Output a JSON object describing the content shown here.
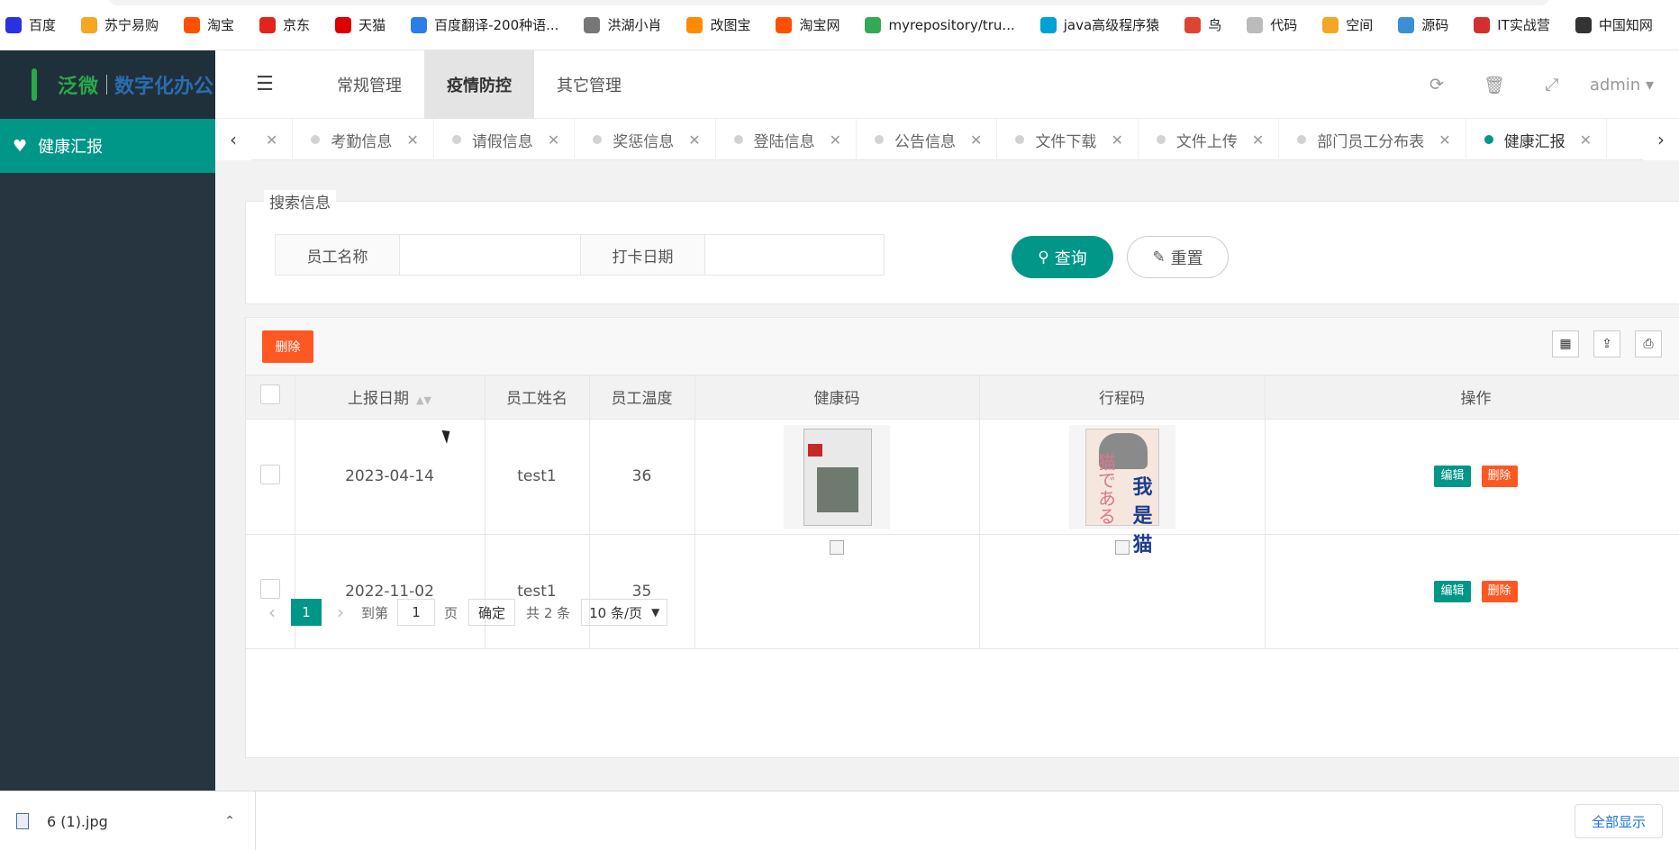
{
  "bookmarks": [
    {
      "label": "百度",
      "color": "#2932e1",
      "icon": "baidu-icon"
    },
    {
      "label": "苏宁易购",
      "color": "#f5a623",
      "icon": "suning-icon"
    },
    {
      "label": "淘宝",
      "color": "#ff5000",
      "icon": "taobao-icon"
    },
    {
      "label": "京东",
      "color": "#e1251b",
      "icon": "jd-icon"
    },
    {
      "label": "天猫",
      "color": "#d00",
      "icon": "tmall-icon"
    },
    {
      "label": "百度翻译-200种语...",
      "color": "#2b7de9",
      "icon": "translate-icon"
    },
    {
      "label": "洪湖小肖",
      "color": "#777",
      "icon": "bird-icon"
    },
    {
      "label": "改图宝",
      "color": "#ff8a00",
      "icon": "gaitubao-icon"
    },
    {
      "label": "淘宝网",
      "color": "#ff5000",
      "icon": "taobao-icon"
    },
    {
      "label": "myrepository/tru...",
      "color": "#34a853",
      "icon": "chrome-icon"
    },
    {
      "label": "java高级程序猿",
      "color": "#00a1d6",
      "icon": "bilibili-icon"
    },
    {
      "label": "鸟",
      "color": "#d43",
      "icon": "bird-icon"
    },
    {
      "label": "代码",
      "color": "#bbb",
      "icon": "code-icon"
    },
    {
      "label": "空间",
      "color": "#f5a623",
      "icon": "qzone-icon"
    },
    {
      "label": "源码",
      "color": "#3a8fd8",
      "icon": "source-icon"
    },
    {
      "label": "IT实战营",
      "color": "#d32f2f",
      "icon": "chrome-icon"
    },
    {
      "label": "中国知网",
      "color": "#333",
      "icon": "cnki-icon"
    }
  ],
  "logo": {
    "brand": "泛微",
    "product": "数字化办公"
  },
  "sidebar": {
    "items": [
      {
        "label": "健康汇报",
        "icon": "heart-icon"
      }
    ]
  },
  "header": {
    "nav": [
      "常规管理",
      "疫情防控",
      "其它管理"
    ],
    "active_nav": "疫情防控",
    "user": "admin"
  },
  "tabs": [
    "考勤信息",
    "请假信息",
    "奖惩信息",
    "登陆信息",
    "公告信息",
    "文件下载",
    "文件上传",
    "部门员工分布表",
    "健康汇报"
  ],
  "active_tab": "健康汇报",
  "search": {
    "legend": "搜索信息",
    "name_label": "员工名称",
    "date_label": "打卡日期",
    "search_button": "查询",
    "reset_button": "重置"
  },
  "toolbar": {
    "delete_button": "删除"
  },
  "table": {
    "columns": [
      "上报日期",
      "员工姓名",
      "员工温度",
      "健康码",
      "行程码",
      "操作"
    ],
    "rows": [
      {
        "date": "2023-04-14",
        "name": "test1",
        "temp": "36",
        "health_code_image": "book-cover",
        "trip_code_image": "book-cover"
      },
      {
        "date": "2022-11-02",
        "name": "test1",
        "temp": "35",
        "health_code_image": "broken",
        "trip_code_image": "broken"
      }
    ],
    "edit_label": "编辑",
    "delete_label": "删除"
  },
  "pagination": {
    "current": "1",
    "goto_label": "到第",
    "page_input": "1",
    "page_unit": "页",
    "confirm": "确定",
    "total": "共 2 条",
    "page_size": "10 条/页"
  },
  "download": {
    "file": "6 (1).jpg",
    "show_all": "全部显示"
  }
}
